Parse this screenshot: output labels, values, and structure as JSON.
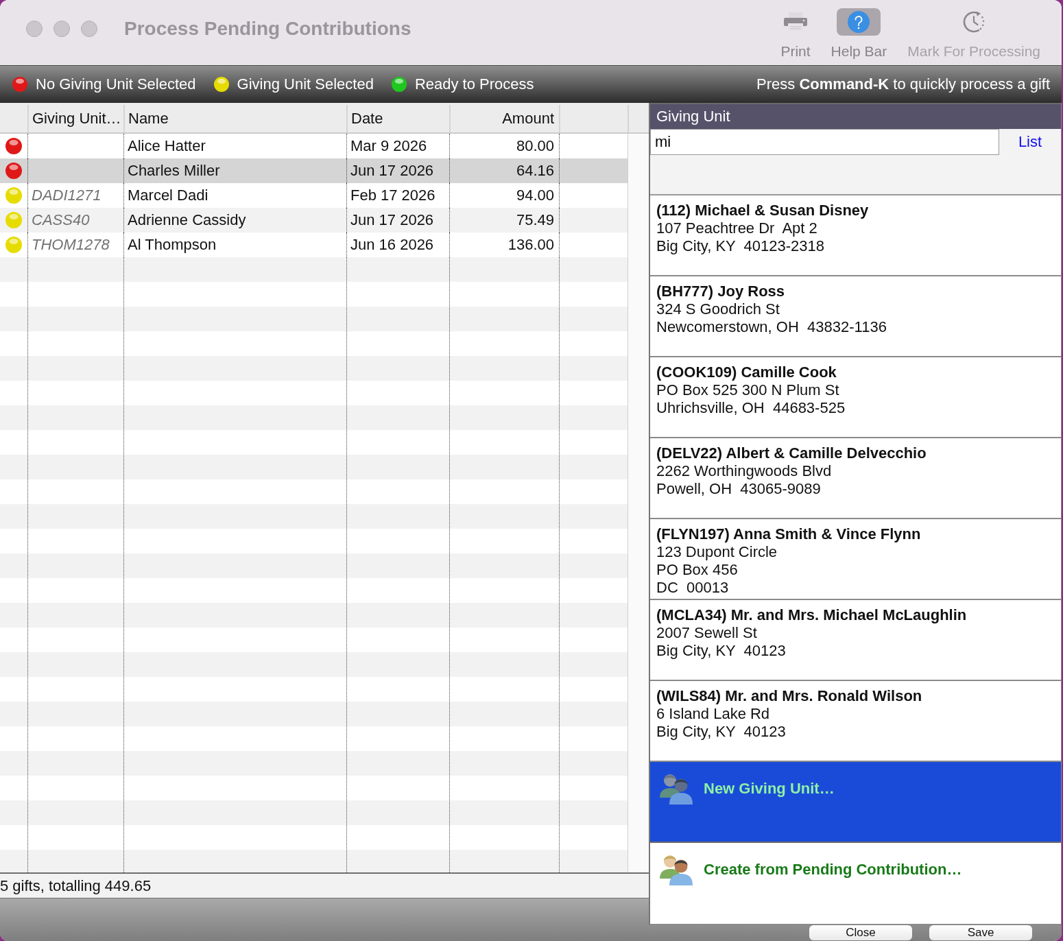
{
  "window": {
    "title": "Process Pending Contributions"
  },
  "toolbar": [
    {
      "kind": "print",
      "label": "Print",
      "selected": false,
      "disabled": false
    },
    {
      "kind": "help",
      "label": "Help Bar",
      "selected": true,
      "disabled": false
    },
    {
      "kind": "clock",
      "label": "Mark For Processing",
      "selected": false,
      "disabled": true
    }
  ],
  "legend": [
    {
      "label": "No Giving Unit Selected",
      "color": "#e01818"
    },
    {
      "label": "Giving Unit Selected",
      "color": "#e6dc00"
    },
    {
      "label": "Ready to Process",
      "color": "#1ec81e"
    }
  ],
  "shortcut_hint": "Press **Command-K** to quickly process a gift",
  "table": {
    "columns": [
      "Giving Unit…",
      "Name",
      "Date",
      "Amount"
    ],
    "rows": [
      {
        "name": "Alice Hatter",
        "date": "Mar 9 2026",
        "amount": "80.00",
        "color": "#e01818",
        "selected": false
      },
      {
        "name": "Charles Miller",
        "date": "Jun 17 2026",
        "amount": "64.16",
        "color": "#e01818",
        "selected": true
      },
      {
        "giving_unit": "DADI1271",
        "name": "Marcel Dadi",
        "date": "Feb 17 2026",
        "amount": "94.00",
        "color": "#e6dc00",
        "selected": false
      },
      {
        "giving_unit": "CASS40",
        "name": "Adrienne Cassidy",
        "date": "Jun 17 2026",
        "amount": "75.49",
        "color": "#e6dc00",
        "selected": false
      },
      {
        "giving_unit": "THOM1278",
        "name": "Al Thompson",
        "date": "Jun 16 2026",
        "amount": "136.00",
        "color": "#e6dc00",
        "selected": false
      }
    ]
  },
  "status_bar": "5 gifts, totalling 449.65",
  "giving_unit_panel": {
    "title": "Giving Unit",
    "search": {
      "value": "mi"
    },
    "list_link": "List",
    "results": [
      {
        "kind": "contact",
        "title": "(112) Michael & Susan Disney",
        "lines": [
          "107 Peachtree Dr  Apt 2",
          "Big City, KY  40123-2318"
        ],
        "selected": false
      },
      {
        "kind": "contact",
        "title": "(BH777) Joy Ross",
        "lines": [
          "324 S Goodrich St",
          "Newcomerstown, OH  43832-1136"
        ],
        "selected": false
      },
      {
        "kind": "contact",
        "title": "(COOK109) Camille Cook",
        "lines": [
          "PO Box 525 300 N Plum St",
          "Uhrichsville, OH  44683-525"
        ],
        "selected": false
      },
      {
        "kind": "contact",
        "title": "(DELV22) Albert & Camille Delvecchio",
        "lines": [
          "2262 Worthingwoods Blvd",
          "Powell, OH  43065-9089"
        ],
        "selected": false
      },
      {
        "kind": "contact",
        "title": "(FLYN197) Anna Smith & Vince Flynn",
        "lines": [
          "123 Dupont Circle",
          "PO Box 456",
          "DC  00013"
        ],
        "selected": false
      },
      {
        "kind": "contact",
        "title": "(MCLA34) Mr. and Mrs. Michael McLaughlin",
        "lines": [
          "2007 Sewell St",
          "Big City, KY  40123"
        ],
        "selected": false
      },
      {
        "kind": "contact",
        "title": "(WILS84) Mr. and Mrs. Ronald Wilson",
        "lines": [
          "6 Island Lake Rd",
          "Big City, KY  40123"
        ],
        "selected": false
      },
      {
        "kind": "action",
        "label": "New Giving Unit…",
        "selected": true
      },
      {
        "kind": "action",
        "label": "Create from Pending Contribution…",
        "selected": false
      }
    ]
  },
  "buttons": [
    "Close",
    "Save"
  ]
}
